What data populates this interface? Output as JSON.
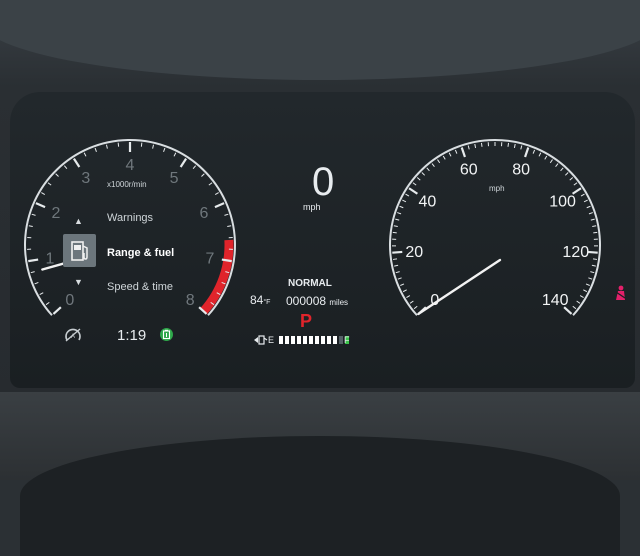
{
  "tachometer": {
    "ticks": [
      "0",
      "1",
      "2",
      "3",
      "4",
      "5",
      "6",
      "7",
      "8"
    ],
    "unit_label": "x1000r/min",
    "current_rpm": 0.8
  },
  "speedometer": {
    "ticks": [
      "0",
      "20",
      "40",
      "60",
      "80",
      "100",
      "120",
      "140"
    ],
    "unit_label": "mph",
    "needle_mph": 0
  },
  "digital_speed": {
    "value": "0",
    "unit": "mph"
  },
  "menu": {
    "items": [
      "Warnings",
      "Range & fuel",
      "Speed & time"
    ],
    "selected_index": 1
  },
  "clock": "1:19",
  "drive_mode": "NORMAL",
  "temperature": "84",
  "temperature_unit": "°F",
  "odometer": "000008",
  "odometer_unit": "miles",
  "gear": "P",
  "fuel": {
    "empty_label": "E",
    "full_label": "F",
    "level": 0.85,
    "segments": 12
  },
  "colors": {
    "redline": "#e0242b",
    "needle": "#f2f2f2",
    "gear_park": "#e0242b",
    "battery_indicator": "#2ea84a",
    "warning_light": "#e3206a"
  }
}
